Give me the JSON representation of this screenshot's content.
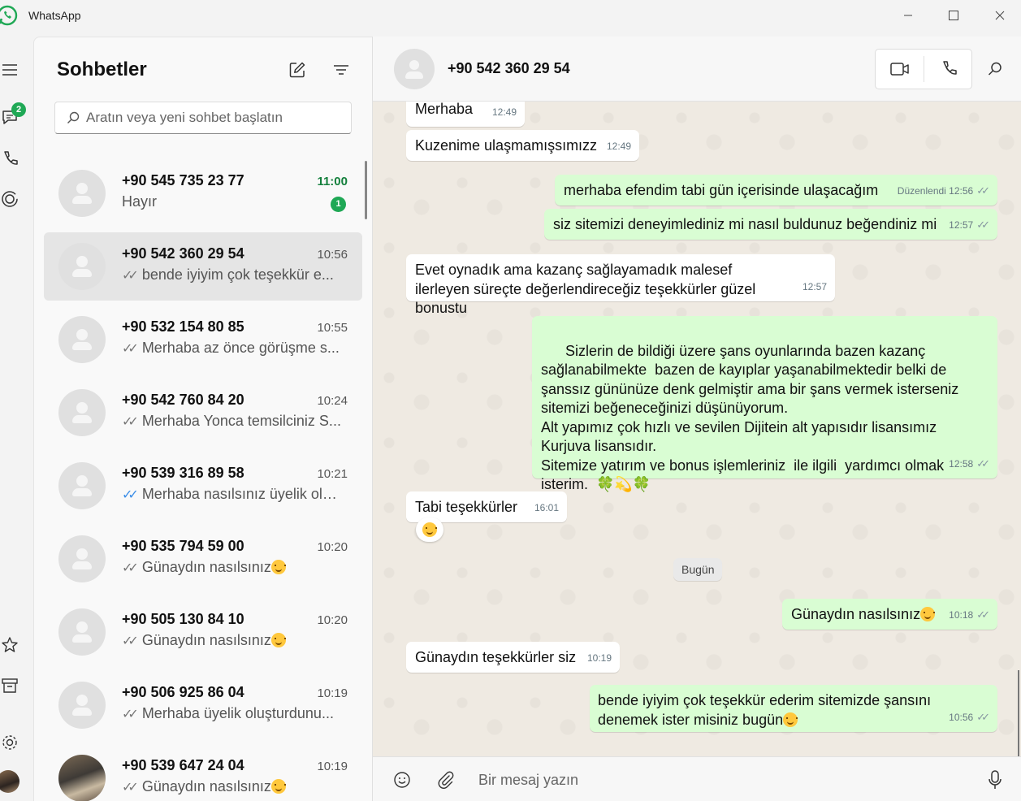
{
  "app": {
    "title": "WhatsApp"
  },
  "colors": {
    "accent": "#1fa855",
    "outgoing_bubble": "#d9fdd3",
    "incoming_bubble": "#ffffff",
    "read_tick": "#3b8ee8"
  },
  "rail": {
    "chats_badge": "2",
    "icons": [
      "menu-icon",
      "chats-icon",
      "calls-icon",
      "status-icon",
      "starred-icon",
      "archive-icon",
      "settings-icon",
      "profile-avatar"
    ]
  },
  "chatlist": {
    "title": "Sohbetler",
    "search_placeholder": "Aratın veya yeni sohbet başlatın",
    "items": [
      {
        "name": "+90 545 735 23 77",
        "time": "11:00",
        "preview": "Hayır",
        "unread": "1",
        "tick": "",
        "emoji": false,
        "active": false,
        "photo": false
      },
      {
        "name": "+90 542 360 29 54",
        "time": "10:56",
        "preview": "bende iyiyim çok teşekkür e...",
        "unread": "",
        "tick": "sent",
        "emoji": false,
        "active": true,
        "photo": false
      },
      {
        "name": "+90 532 154 80 85",
        "time": "10:55",
        "preview": "Merhaba az önce görüşme s...",
        "unread": "",
        "tick": "sent",
        "emoji": false,
        "active": false,
        "photo": false
      },
      {
        "name": "+90 542 760 84 20",
        "time": "10:24",
        "preview": "Merhaba Yonca temsilciniz S...",
        "unread": "",
        "tick": "sent",
        "emoji": false,
        "active": false,
        "photo": false
      },
      {
        "name": "+90 539 316 89 58",
        "time": "10:21",
        "preview": "Merhaba nasılsınız üyelik olu...",
        "unread": "",
        "tick": "read",
        "emoji": false,
        "active": false,
        "photo": false
      },
      {
        "name": "+90 535 794 59 00",
        "time": "10:20",
        "preview": "Günaydın nasılsınız",
        "unread": "",
        "tick": "sent",
        "emoji": true,
        "active": false,
        "photo": false
      },
      {
        "name": "+90 505 130 84 10",
        "time": "10:20",
        "preview": "Günaydın nasılsınız",
        "unread": "",
        "tick": "sent",
        "emoji": true,
        "active": false,
        "photo": false
      },
      {
        "name": "+90 506 925 86 04",
        "time": "10:19",
        "preview": "Merhaba üyelik oluşturdunu...",
        "unread": "",
        "tick": "sent",
        "emoji": false,
        "active": false,
        "photo": false
      },
      {
        "name": "+90 539 647 24 04",
        "time": "10:19",
        "preview": "Günaydın nasılsınız",
        "unread": "",
        "tick": "sent",
        "emoji": true,
        "active": false,
        "photo": true
      }
    ]
  },
  "conversation": {
    "contact": "+90 542 360 29 54",
    "messages": [
      {
        "dir": "in",
        "text": "Merhaba",
        "time": "12:49"
      },
      {
        "dir": "in",
        "text": "Kuzenime ulaşmamışsımızz",
        "time": "12:49"
      },
      {
        "dir": "out",
        "text": "merhaba efendim tabi gün içerisinde ulaşacağım",
        "time": "Düzenlendi 12:56"
      },
      {
        "dir": "out",
        "text": "siz sitemizi deneyimlediniz mi nasıl buldunuz beğendiniz mi",
        "time": "12:57"
      },
      {
        "dir": "in",
        "text": "Evet oynadık ama kazanç sağlayamadık malesef ilerleyen süreçte değerlendireceğiz teşekkürler güzel bonustu",
        "time": "12:57"
      },
      {
        "dir": "out",
        "text": "Sizlerin de bildiği üzere şans oyunlarında bazen kazanç sağlanabilmekte  bazen de kayıplar yaşanabilmektedir belki de şanssız gününüze denk gelmiştir ama bir şans vermek isterseniz sitemizi beğeneceğinizi düşünüyorum.\nAlt yapımız çok hızlı ve sevilen Dijitein alt yapısıdır lisansımız Kurjuva lisansıdır.\nSitemize yatırım ve bonus işlemleriniz  ile ilgili  yardımcı olmak isterim.  🍀💫🍀",
        "time": "12:58"
      },
      {
        "dir": "in",
        "text": "Tabi teşekkürler",
        "time": "16:01"
      },
      {
        "dir": "out",
        "text": "Günaydın nasılsınız",
        "time": "10:18"
      },
      {
        "dir": "in",
        "text": "Günaydın teşekkürler siz",
        "time": "10:19"
      },
      {
        "dir": "out",
        "text": "bende iyiyim çok teşekkür ederim sitemizde şansını denemek ister misiniz bugün",
        "time": "10:56"
      }
    ],
    "date_chip": "Bugün",
    "composer_placeholder": "Bir mesaj yazın"
  }
}
